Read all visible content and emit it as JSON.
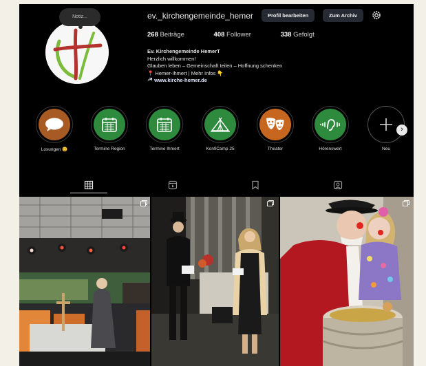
{
  "profile": {
    "username": "ev._kirchengemeinde_hemer",
    "note_placeholder": "Notiz...",
    "buttons": {
      "edit_profile": "Profil bearbeiten",
      "archive": "Zum Archiv"
    },
    "stats": {
      "posts_count": "268",
      "posts_label": "Beiträge",
      "followers_count": "408",
      "followers_label": "Follower",
      "following_count": "338",
      "following_label": "Gefolgt"
    },
    "bio": {
      "name": "Ev. Kirchengemeinde HemerT",
      "line1": "Herzlich willkommen!",
      "line2": "Glauben leben – Gemeinschaft teilen – Hoffnung schenken",
      "line3": "📍 Hemer-Ihmert | Mehr Infos 👇",
      "link": "www.kirche-hemer.de"
    }
  },
  "highlights": [
    {
      "label": "Losungen 😊",
      "icon": "speech-bubble-icon",
      "color": "#a85a25"
    },
    {
      "label": "Termine Region",
      "icon": "calendar-icon",
      "color": "#2e8b3d"
    },
    {
      "label": "Termine Ihmert",
      "icon": "calendar-icon",
      "color": "#2e8b3d"
    },
    {
      "label": "KonfiCamp 25",
      "icon": "tent-icon",
      "color": "#2e8b3d"
    },
    {
      "label": "Theater",
      "icon": "theater-masks-icon",
      "color": "#c7671f"
    },
    {
      "label": "Hörenswert",
      "icon": "listening-ear-icon",
      "color": "#2e8b3d"
    },
    {
      "label": "Neu",
      "icon": "plus-icon",
      "color": "#000000"
    }
  ],
  "tabs": [
    "grid-icon",
    "reels-icon",
    "saved-icon",
    "tagged-icon"
  ],
  "colors": {
    "background": "#000000",
    "button": "#262a33",
    "accent_green": "#2e8b3d",
    "accent_orange": "#c7671f"
  }
}
